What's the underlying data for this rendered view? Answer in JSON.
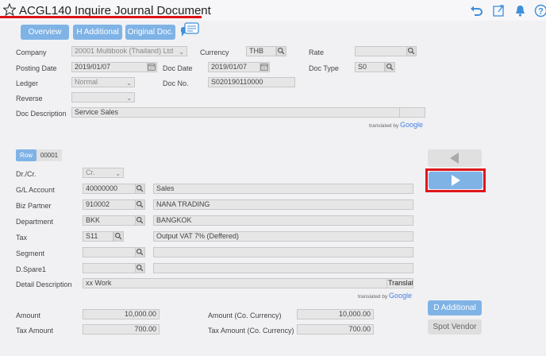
{
  "header": {
    "title": "ACGL140 Inquire Journal Document",
    "icons": [
      "star-icon",
      "undo-icon",
      "export-icon",
      "bell-icon",
      "help-icon"
    ]
  },
  "toolbar": {
    "overview": "Overview",
    "h_additional": "H Additional",
    "original_doc": "Original Doc."
  },
  "header_form": {
    "company_label": "Company",
    "company_value": "20001 Multibook (Thailand) Ltd",
    "currency_label": "Currency",
    "currency_value": "THB",
    "rate_label": "Rate",
    "rate_value": "",
    "posting_date_label": "Posting Date",
    "posting_date_value": "2019/01/07",
    "doc_date_label": "Doc Date",
    "doc_date_value": "2019/01/07",
    "doc_type_label": "Doc Type",
    "doc_type_value": "S0",
    "ledger_label": "Ledger",
    "ledger_value": "Normal",
    "doc_no_label": "Doc No.",
    "doc_no_value": "S020190110000",
    "reverse_label": "Reverse",
    "reverse_value": "",
    "doc_description_label": "Doc Description",
    "doc_description_value": "Service Sales",
    "translated_by": "translated by",
    "google": "Google"
  },
  "row": {
    "tab_label": "Row",
    "row_number": "00001"
  },
  "detail_form": {
    "drcr_label": "Dr./Cr.",
    "drcr_value": "Cr.",
    "gl_account_label": "G/L Account",
    "gl_account_code": "40000000",
    "gl_account_name": "Sales",
    "biz_partner_label": "Biz Partner",
    "biz_partner_code": "910002",
    "biz_partner_name": "NANA TRADING",
    "department_label": "Department",
    "department_code": "BKK",
    "department_name": "BANGKOK",
    "tax_label": "Tax",
    "tax_code": "S11",
    "tax_name": "Output VAT 7% (Deffered)",
    "segment_label": "Segment",
    "segment_code": "",
    "segment_name": "",
    "dspare1_label": "D.Spare1",
    "dspare1_code": "",
    "dspare1_name": "",
    "detail_description_label": "Detail Description",
    "detail_description_value": "xx Work",
    "translate_button": "Translat",
    "translated_by": "translated by",
    "google": "Google"
  },
  "amounts": {
    "amount_label": "Amount",
    "amount_value": "10,000.00",
    "amount_cc_label": "Amount (Co. Currency)",
    "amount_cc_value": "10,000.00",
    "tax_amount_label": "Tax Amount",
    "tax_amount_value": "700.00",
    "tax_amount_cc_label": "Tax Amount (Co. Currency)",
    "tax_amount_cc_value": "700.00"
  },
  "side_buttons": {
    "d_additional": "D Additional",
    "spot_vendor": "Spot Vendor"
  },
  "colors": {
    "accent": "#7fb3e6",
    "highlight_border": "#e0161b",
    "field_bg": "#e6e6e6"
  }
}
